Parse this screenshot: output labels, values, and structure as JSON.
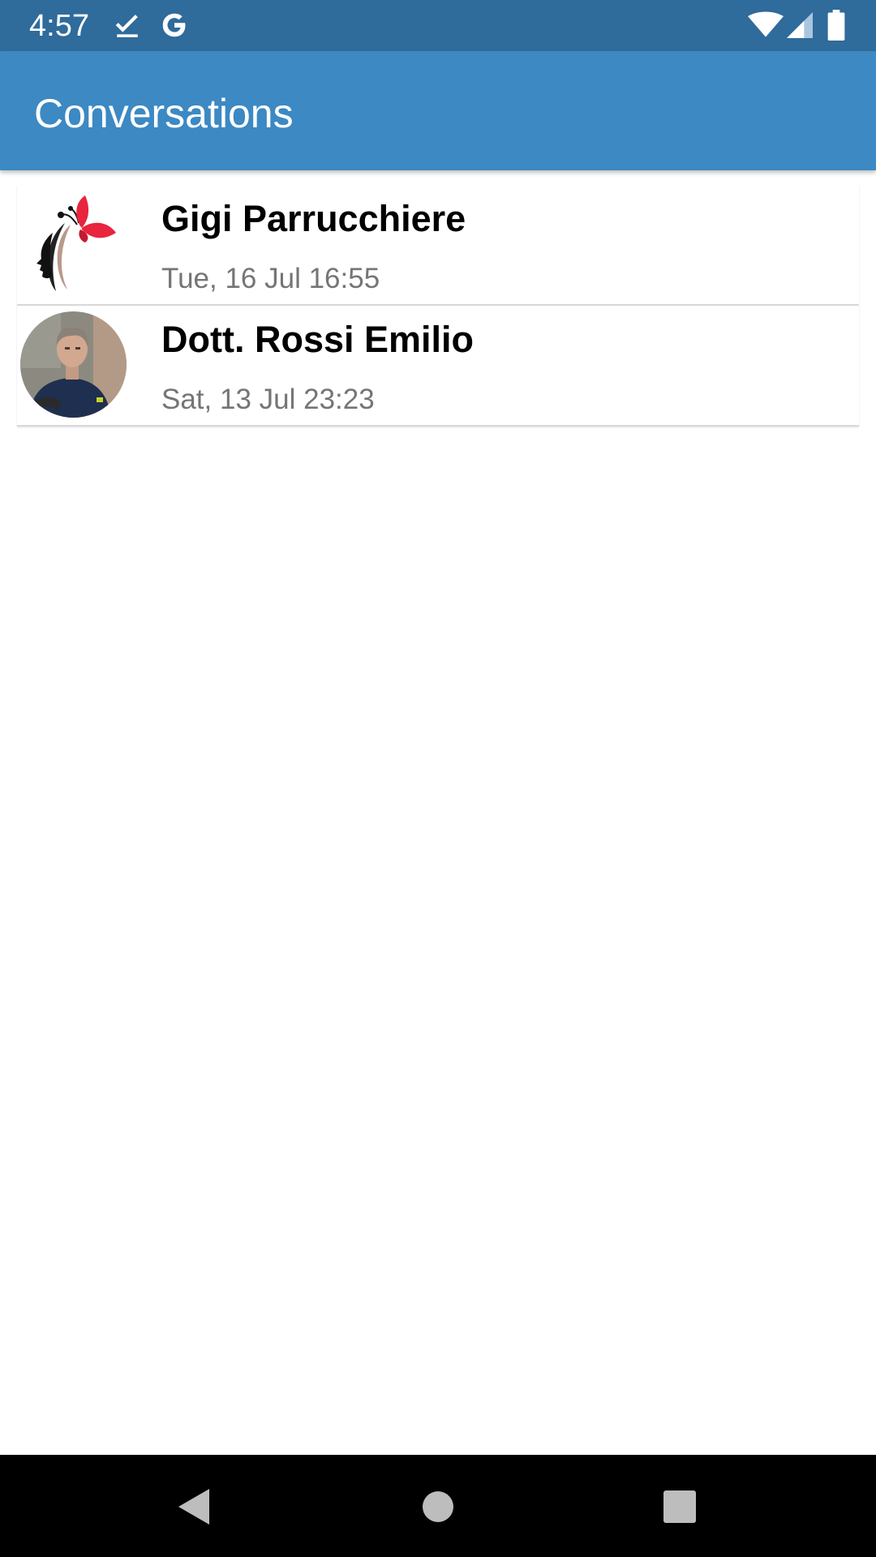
{
  "status_bar": {
    "time": "4:57",
    "icons_left": [
      "download-done-icon",
      "google-icon"
    ],
    "icons_right": [
      "wifi-icon",
      "signal-icon",
      "battery-icon"
    ]
  },
  "app_bar": {
    "title": "Conversations",
    "color": "#3c89c3"
  },
  "conversations": [
    {
      "name": "Gigi Parrucchiere",
      "date": "Tue, 16 Jul 16:55",
      "avatar_icon": "butterfly-woman-logo-icon"
    },
    {
      "name": "Dott. Rossi Emilio",
      "date": "Sat, 13 Jul 23:23",
      "avatar_icon": "person-photo-avatar"
    }
  ],
  "nav_bar": {
    "buttons": [
      "back-icon",
      "home-icon",
      "recents-icon"
    ]
  }
}
